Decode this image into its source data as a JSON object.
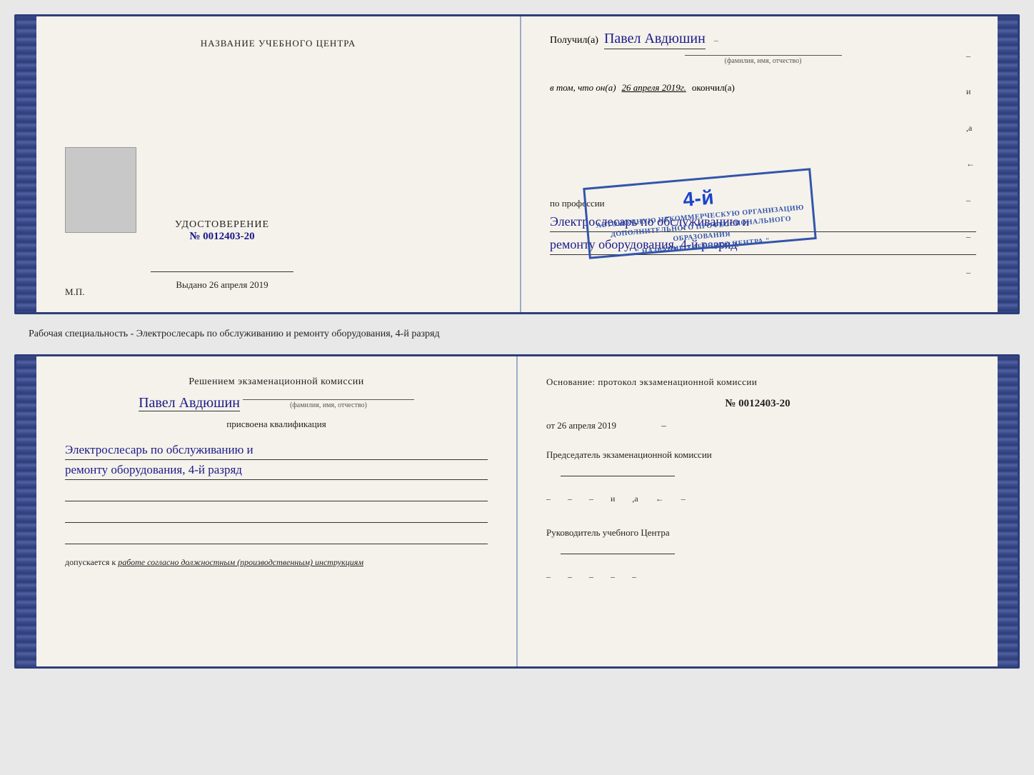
{
  "top_left": {
    "training_center": "НАЗВАНИЕ УЧЕБНОГО ЦЕНТРА",
    "udostoverenie_label": "УДОСТОВЕРЕНИЕ",
    "number": "№ 0012403-20",
    "vydano_label": "Выдано",
    "vydano_date": "26 апреля 2019",
    "mp_label": "М.П."
  },
  "top_right": {
    "poluchil_label": "Получил(a)",
    "name": "Павел Авдюшин",
    "fio_label": "(фамилия, имя, отчество)",
    "vtom_label": "в том, что он(а)",
    "date_italic": "26 апреля 2019г.",
    "okonchil_label": "окончил(а)",
    "stamp_line1": "АВТОНОМНУЮ НЕКОММЕРЧЕСКУЮ ОРГАНИЗАЦИЮ",
    "stamp_line2": "ДОПОЛНИТЕЛЬНОГО ПРОФЕССИОНАЛЬНОГО ОБРАЗОВАНИЯ",
    "stamp_line3": "\" НАЗВАНИЕ УЧЕБНОГО ЦЕНТРА \"",
    "stamp_number": "4-й",
    "professii_label": "по профессии",
    "profession_line1": "Электрослесарь по обслуживанию и",
    "profession_line2": "ремонту оборудования, 4-й разряд"
  },
  "middle_strip": {
    "text": "Рабочая специальность - Электрослесарь по обслуживанию и ремонту оборудования, 4-й разряд"
  },
  "bottom_left": {
    "komissia_text": "Решением экзаменационной комиссии",
    "name": "Павел Авдюшин",
    "fio_label": "(фамилия, имя, отчество)",
    "prisvoena_label": "присвоена квалификация",
    "profession_line1": "Электрослесарь по обслуживанию и",
    "profession_line2": "ремонту оборудования, 4-й разряд",
    "dopuskaetsya_label": "допускается к",
    "dopusk_text": "работе согласно должностным (производственным) инструкциям"
  },
  "bottom_right": {
    "osnovanie_text": "Основание: протокол экзаменационной комиссии",
    "number": "№  0012403-20",
    "ot_label": "от",
    "ot_date": "26 апреля 2019",
    "predsedatel_label": "Председатель экзаменационной комиссии",
    "rukovoditel_label": "Руководитель учебного Центра"
  },
  "right_edge": {
    "marks": [
      "и",
      "а",
      "←",
      "–",
      "–",
      "–",
      "–"
    ]
  }
}
